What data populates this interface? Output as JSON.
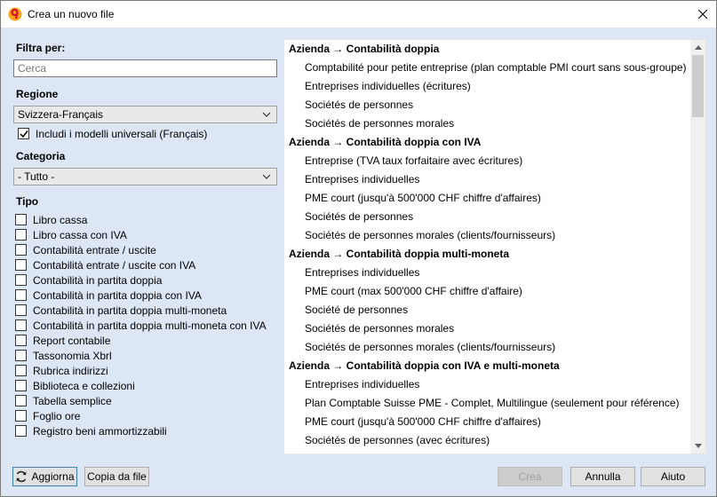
{
  "window": {
    "title": "Crea un nuovo file",
    "close_icon": "close-icon"
  },
  "filter": {
    "label": "Filtra per:",
    "placeholder": "Cerca",
    "value": ""
  },
  "region": {
    "label": "Regione",
    "selected": "Svizzera-Français",
    "universal_label": "Includi i modelli universali (Français)",
    "universal_checked": true
  },
  "category": {
    "label": "Categoria",
    "selected": "- Tutto -"
  },
  "type": {
    "label": "Tipo",
    "options": [
      "Libro cassa",
      "Libro cassa con IVA",
      "Contabilità entrate / uscite",
      "Contabilità entrate / uscite con IVA",
      "Contabilità in partita doppia",
      "Contabilità in partita doppia con IVA",
      "Contabilità in partita doppia multi-moneta",
      "Contabilità in partita doppia multi-moneta con IVA",
      "Report contabile",
      "Tassonomia Xbrl",
      "Rubrica indirizzi",
      "Biblioteca e collezioni",
      "Tabella semplice",
      "Foglio ore",
      "Registro beni ammortizzabili"
    ]
  },
  "templates": [
    {
      "group": "Azienda → Contabilità doppia",
      "items": [
        "Comptabilité pour petite entreprise (plan comptable PMI court sans sous-groupe)",
        "Entreprises individuelles (écritures)",
        "Sociétés de personnes",
        "Sociétés de personnes morales"
      ]
    },
    {
      "group": "Azienda → Contabilità doppia con IVA",
      "items": [
        "Entreprise (TVA taux forfaitaire avec écritures)",
        "Entreprises individuelles",
        "PME court (jusqu'à 500'000 CHF chiffre d'affaires)",
        "Sociétés de personnes",
        "Sociétés de personnes morales (clients/fournisseurs)"
      ]
    },
    {
      "group": "Azienda → Contabilità doppia multi-moneta",
      "items": [
        "Entreprises individuelles",
        "PME court (max 500'000 CHF chiffre d'affaire)",
        "Société de personnes",
        "Sociétés de personnes morales",
        "Sociétés de personnes morales (clients/fournisseurs)"
      ]
    },
    {
      "group": "Azienda → Contabilità doppia con IVA e multi-moneta",
      "items": [
        "Entreprises individuelles",
        "Plan Comptable Suisse PME - Complet, Multilingue (seulement pour référence)",
        "PME court (jusqu'à 500'000 CHF chiffre d'affaires)",
        "Sociétés de personnes (avec écritures)"
      ]
    }
  ],
  "buttons": {
    "refresh": "Aggiorna",
    "copy_from_file": "Copia da file",
    "create": "Crea",
    "cancel": "Annulla",
    "help": "Aiuto"
  },
  "colors": {
    "dialog_bg": "#dde6f4",
    "app_icon": "#f59a00"
  }
}
